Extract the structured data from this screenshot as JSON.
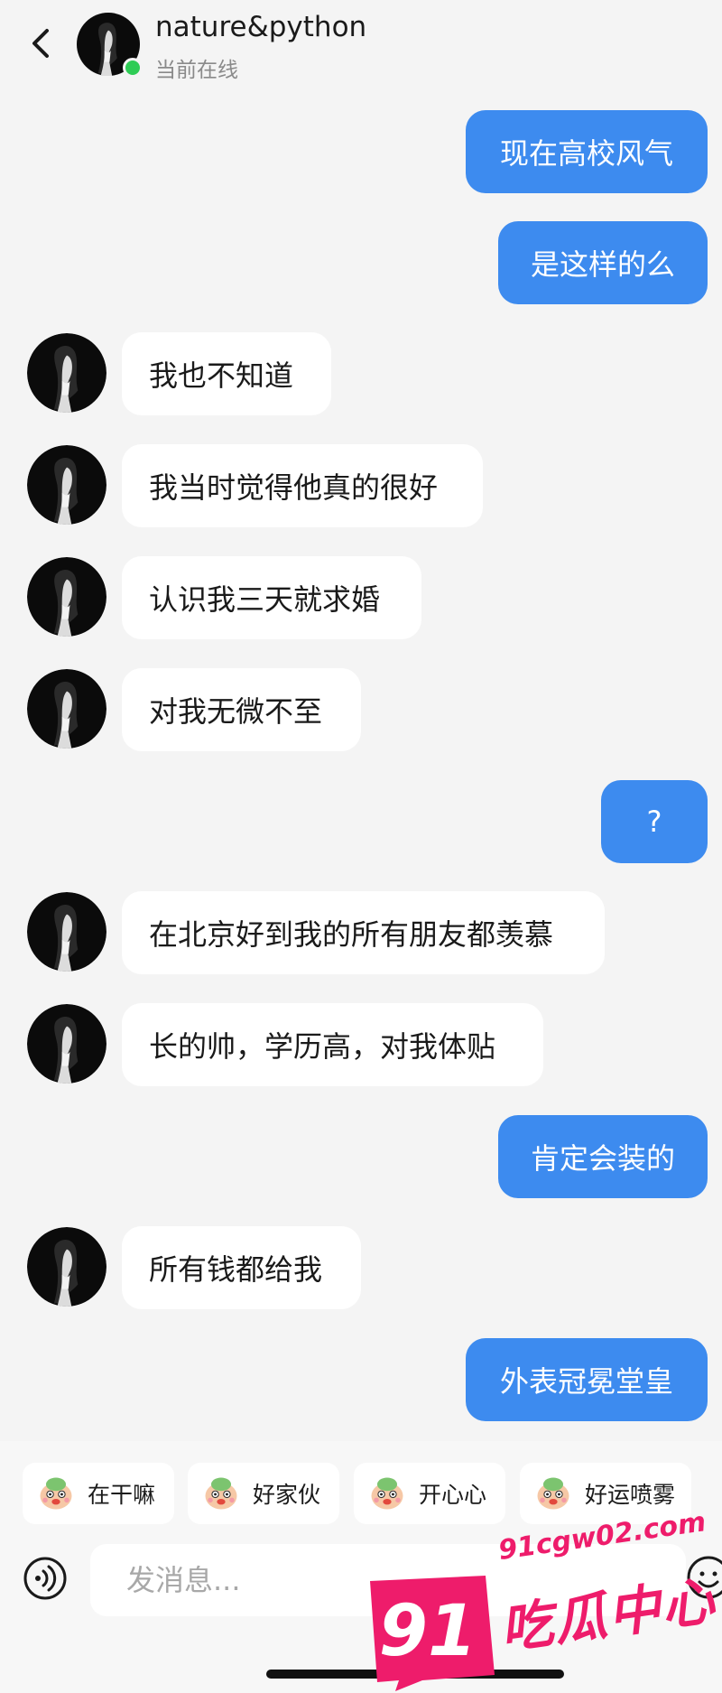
{
  "header": {
    "name": "nature&python",
    "status": "当前在线",
    "back_icon": "chevron-left-icon"
  },
  "messages": [
    {
      "side": "out",
      "text": "现在高校风气"
    },
    {
      "side": "out",
      "text": "是这样的么"
    },
    {
      "side": "in",
      "text": "我也不知道"
    },
    {
      "side": "in",
      "text": "我当时觉得他真的很好"
    },
    {
      "side": "in",
      "text": "认识我三天就求婚"
    },
    {
      "side": "in",
      "text": "对我无微不至"
    },
    {
      "side": "out",
      "text": "?"
    },
    {
      "side": "in",
      "text": "在北京好到我的所有朋友都羡慕"
    },
    {
      "side": "in",
      "text": "长的帅，学历高，对我体贴"
    },
    {
      "side": "out",
      "text": "肯定会装的"
    },
    {
      "side": "in",
      "text": "所有钱都给我"
    },
    {
      "side": "out",
      "text": "外表冠冕堂皇"
    }
  ],
  "quick_stickers": [
    {
      "label": "在干嘛",
      "icon": "sticker-icon"
    },
    {
      "label": "好家伙",
      "icon": "sticker-icon"
    },
    {
      "label": "开心心",
      "icon": "sticker-icon"
    },
    {
      "label": "好运喷雾",
      "icon": "sticker-icon"
    }
  ],
  "composer": {
    "placeholder": "发消息..."
  },
  "watermark": {
    "badge": "91",
    "url": "91cgw02.com",
    "text": "吃瓜中心"
  },
  "colors": {
    "background": "#f4f4f4",
    "outgoing_bubble": "#3d8bef",
    "incoming_bubble": "#ffffff",
    "online_dot": "#2ecc55",
    "watermark": "#ee1c6b"
  }
}
